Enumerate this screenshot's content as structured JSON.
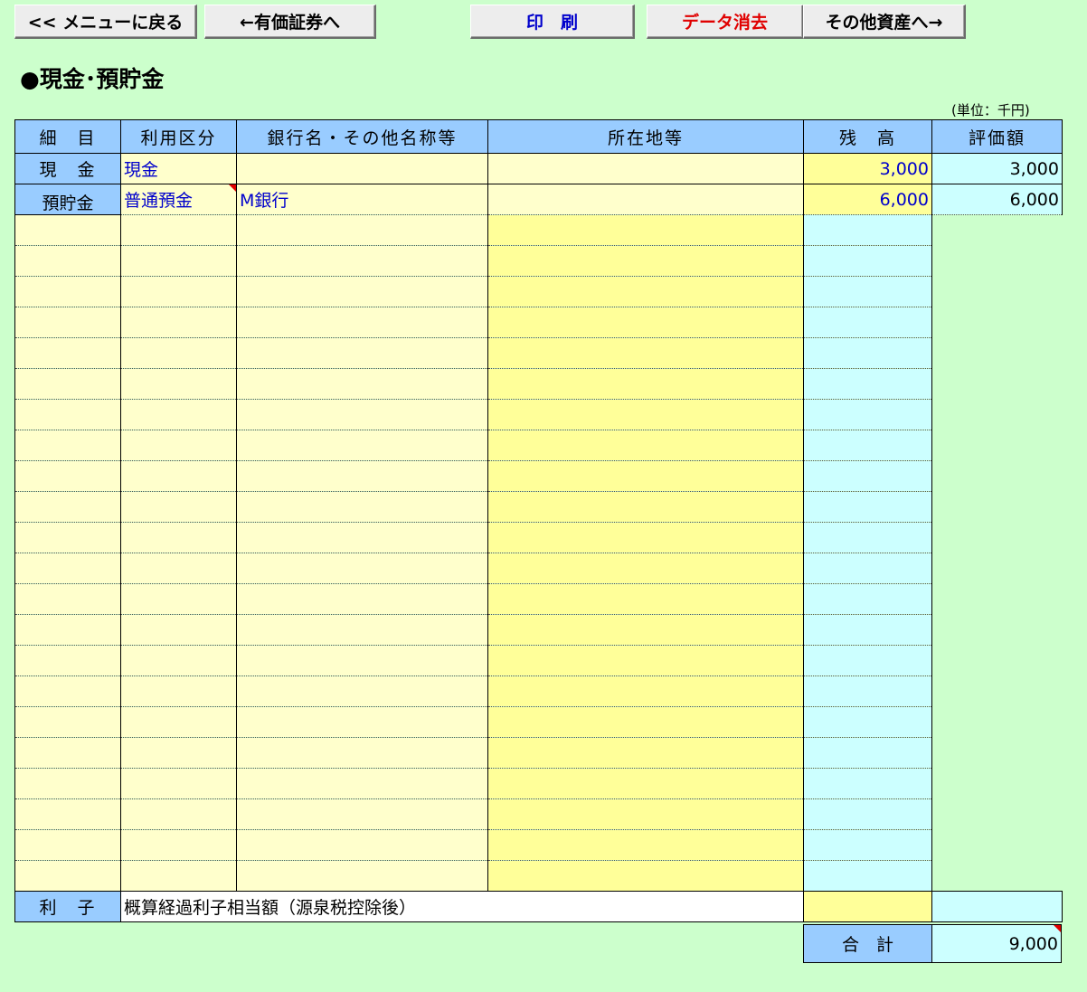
{
  "toolbar": {
    "menu_back": "<< メニューに戻る",
    "prev": "←有価証券へ",
    "print": "印　刷",
    "clear": "データ消去",
    "next": "その他資産へ→"
  },
  "page_title": "●現金･預貯金",
  "unit_note": "(単位：千円)",
  "table": {
    "headers": [
      "細　目",
      "利用区分",
      "銀行名・その他名称等",
      "所在地等",
      "残　高",
      "評価額"
    ],
    "cash": {
      "category": "現　金",
      "usage": "現金",
      "bank": "",
      "location": "",
      "balance": "3,000",
      "value": "3,000"
    },
    "deposit_category": "預貯金",
    "deposits": [
      {
        "usage": "普通預金",
        "bank": "M銀行",
        "location": "",
        "balance": "6,000",
        "value": "6,000"
      }
    ],
    "interest": {
      "category": "利　子",
      "description": "概算経過利子相当額（源泉税控除後）",
      "balance": "",
      "value": ""
    },
    "total": {
      "label": "合　計",
      "value": "9,000"
    }
  },
  "colors": {
    "background": "#ccffcc",
    "header_blue": "#99ccff",
    "input_yellow": "#ffffcc",
    "balance_yellow": "#ffff99",
    "value_cyan": "#ccffff",
    "print_label": "#0000cc",
    "clear_label": "#e00000"
  }
}
